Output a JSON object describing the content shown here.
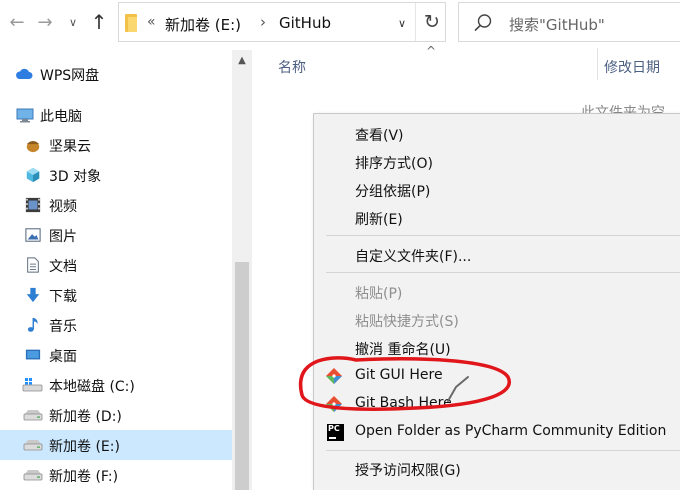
{
  "toolbar": {
    "back_icon": "arrow-left-icon",
    "forward_icon": "arrow-right-icon",
    "recent_icon": "chevron-down-icon",
    "up_icon": "arrow-up-icon",
    "back_glyph": "←",
    "forward_glyph": "→",
    "recent_glyph": "∨",
    "up_glyph": "↑"
  },
  "address": {
    "overflow_glyph": "«",
    "drive": "新加卷 (E:)",
    "separator": "›",
    "current": "GitHub",
    "dropdown_glyph": "∨",
    "refresh_glyph": "↻"
  },
  "search": {
    "placeholder": "搜索\"GitHub\""
  },
  "sidebar": {
    "items": [
      {
        "label": "WPS网盘",
        "icon": "cloud-icon"
      },
      {
        "label": "此电脑",
        "icon": "computer-icon"
      },
      {
        "label": "坚果云",
        "icon": "nut-icon"
      },
      {
        "label": "3D 对象",
        "icon": "cube-icon"
      },
      {
        "label": "视频",
        "icon": "film-icon"
      },
      {
        "label": "图片",
        "icon": "picture-icon"
      },
      {
        "label": "文档",
        "icon": "document-icon"
      },
      {
        "label": "下载",
        "icon": "download-icon"
      },
      {
        "label": "音乐",
        "icon": "music-icon"
      },
      {
        "label": "桌面",
        "icon": "desktop-icon"
      },
      {
        "label": "本地磁盘 (C:)",
        "icon": "windows-drive-icon"
      },
      {
        "label": "新加卷 (D:)",
        "icon": "drive-icon"
      },
      {
        "label": "新加卷 (E:)",
        "icon": "drive-icon",
        "selected": true
      },
      {
        "label": "新加卷 (F:)",
        "icon": "drive-icon"
      }
    ]
  },
  "content": {
    "col_name": "名称",
    "col_date": "修改日期",
    "sort_glyph": "^",
    "empty_message": "此文件夹为空"
  },
  "context_menu": {
    "items": [
      {
        "label": "查看(V)"
      },
      {
        "label": "排序方式(O)"
      },
      {
        "label": "分组依据(P)"
      },
      {
        "label": "刷新(E)"
      },
      {
        "label": "自定义文件夹(F)..."
      },
      {
        "label": "粘贴(P)",
        "disabled": true
      },
      {
        "label": "粘贴快捷方式(S)",
        "disabled": true
      },
      {
        "label": "撤消 重命名(U)"
      },
      {
        "label": "Git GUI Here",
        "icon": "git-icon"
      },
      {
        "label": "Git Bash Here",
        "icon": "git-icon"
      },
      {
        "label": "Open Folder as PyCharm Community Edition",
        "icon": "pycharm-icon",
        "icon_text": "PC"
      },
      {
        "label": "授予访问权限(G)"
      }
    ]
  },
  "colors": {
    "selection": "#cce8ff",
    "annotation": "#e0161b",
    "git_red": "#e84e31",
    "git_blue": "#3f8fd2"
  }
}
